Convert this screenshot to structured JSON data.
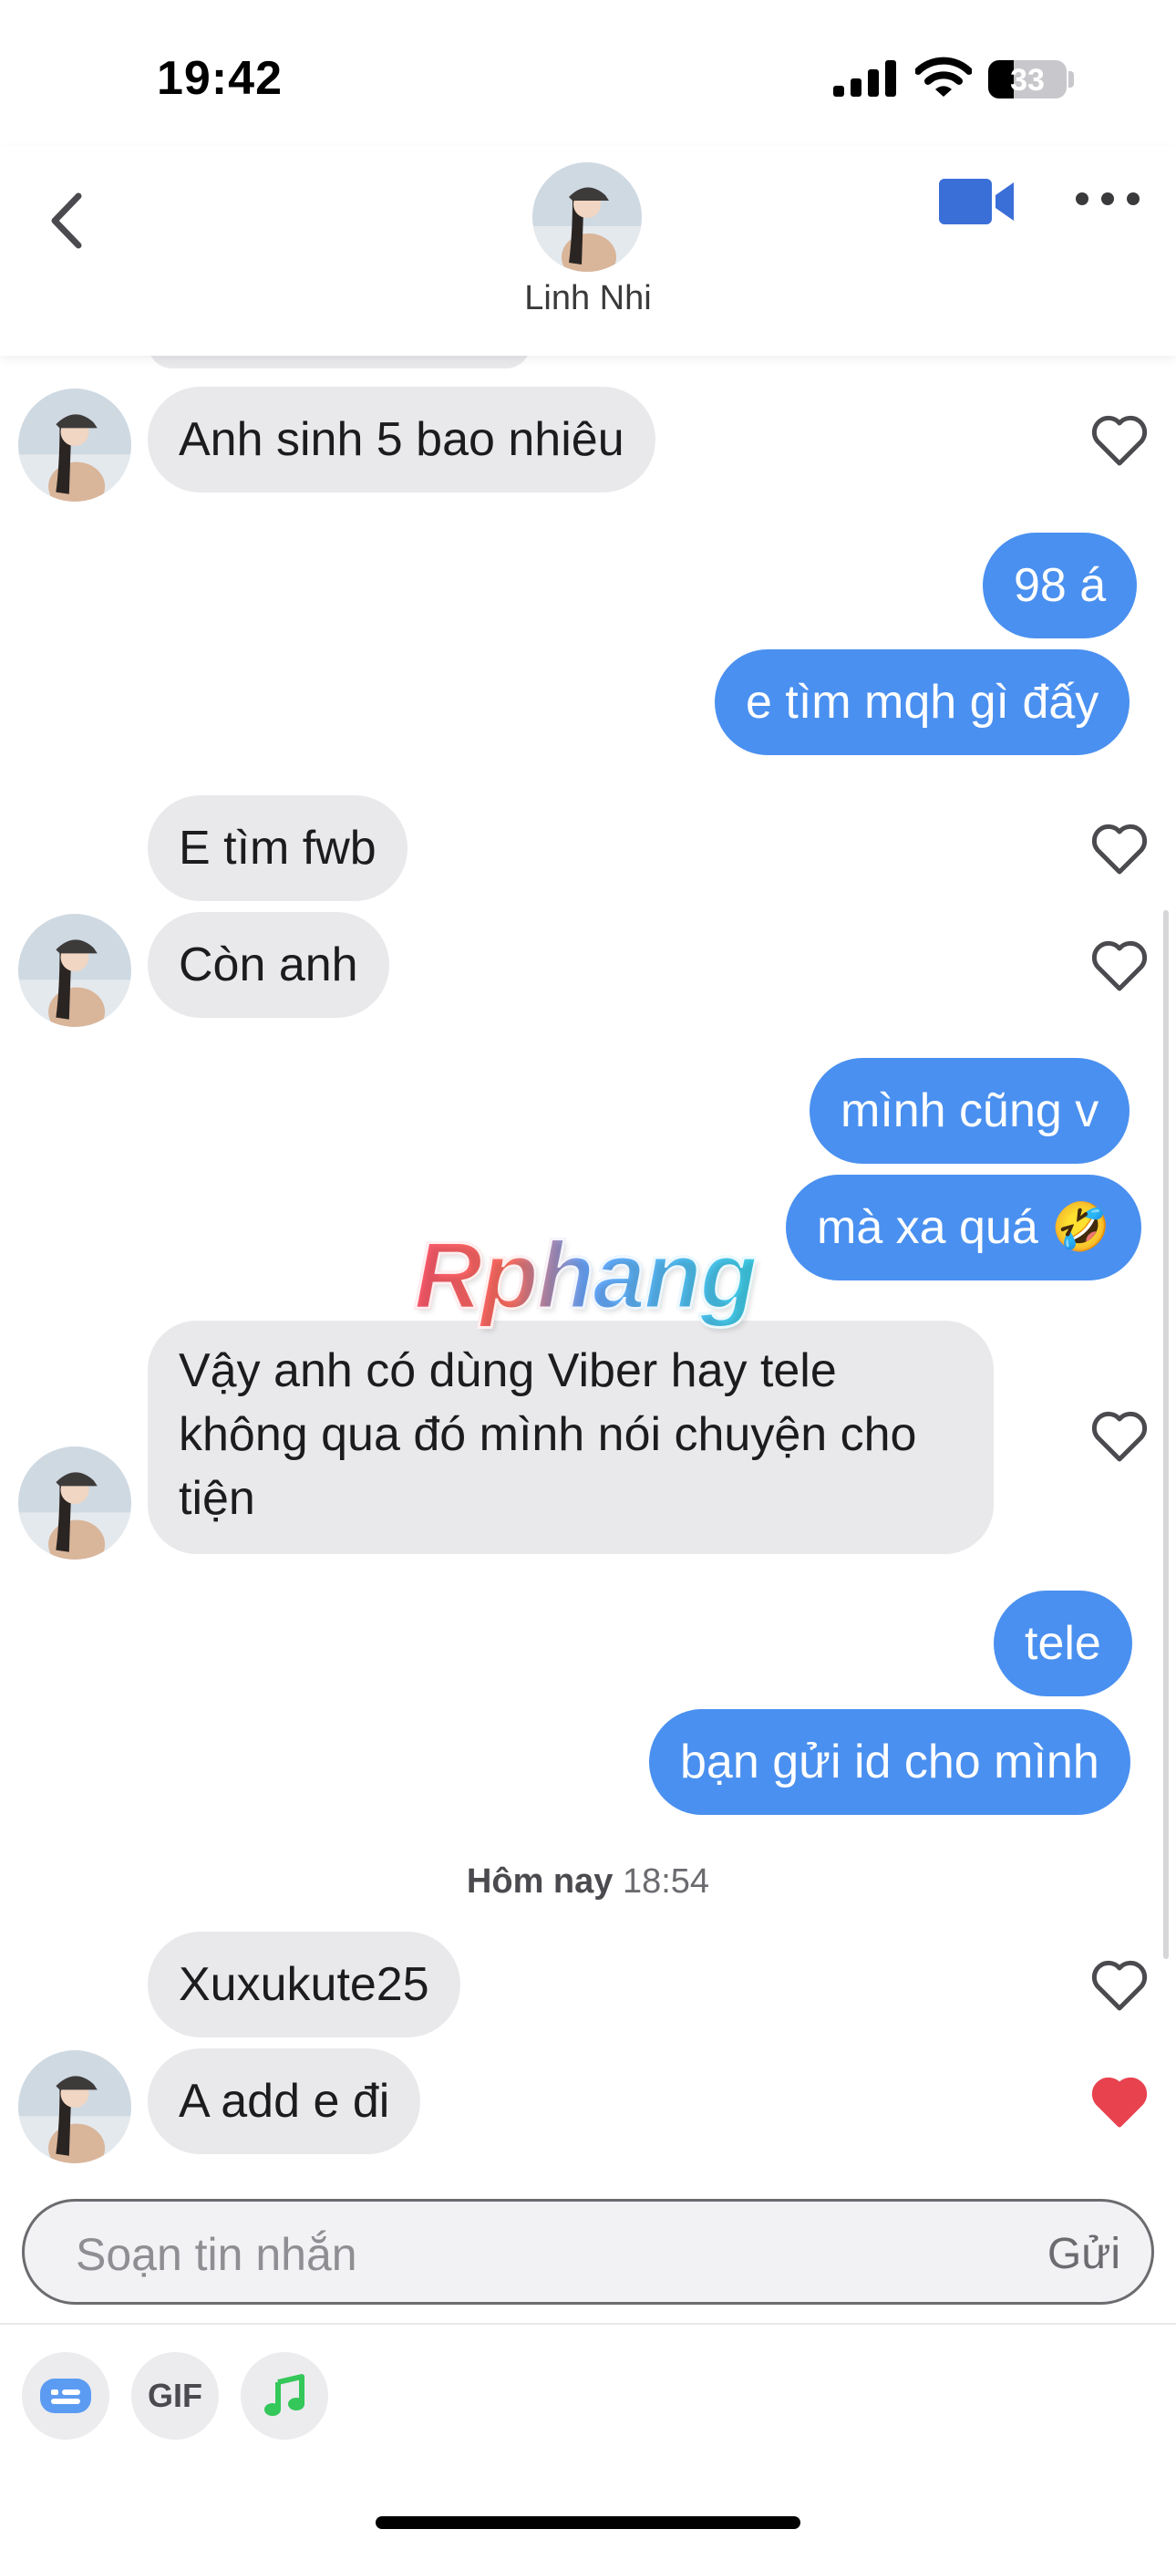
{
  "status_bar": {
    "time": "19:42",
    "battery": "33",
    "battery_level": 0.33
  },
  "header": {
    "contact_name": "Linh Nhi"
  },
  "messages": [
    {
      "side": "in",
      "text": "Anh sinh 5 bao nhiêu"
    },
    {
      "side": "out",
      "text": "98 á"
    },
    {
      "side": "out",
      "text": "e tìm mqh gì đấy"
    },
    {
      "side": "in",
      "text": "E tìm fwb"
    },
    {
      "side": "in",
      "text": "Còn anh"
    },
    {
      "side": "out",
      "text": "mình cũng v"
    },
    {
      "side": "out",
      "text": "mà xa quá 🤣"
    },
    {
      "side": "in",
      "text": "Vậy anh có dùng Viber hay tele không qua đó mình nói chuyện cho tiện"
    },
    {
      "side": "out",
      "text": "tele"
    },
    {
      "side": "out",
      "text": "bạn gửi id cho mình"
    },
    {
      "side": "in",
      "text": "Xuxukute25"
    },
    {
      "side": "in",
      "text": "A add e đi",
      "liked": true
    }
  ],
  "timestamp": {
    "day": "Hôm nay",
    "time": "18:54"
  },
  "watermark": "Rphang",
  "composer": {
    "placeholder": "Soạn tin nhắn",
    "send_label": "Gửi",
    "gif_label": "GIF"
  },
  "colors": {
    "outgoing_bubble": "#4a90f0",
    "incoming_bubble": "#e9e9ec",
    "accent": "#3a6fd8",
    "liked_heart": "#e8424f",
    "music_icon": "#34c759"
  }
}
